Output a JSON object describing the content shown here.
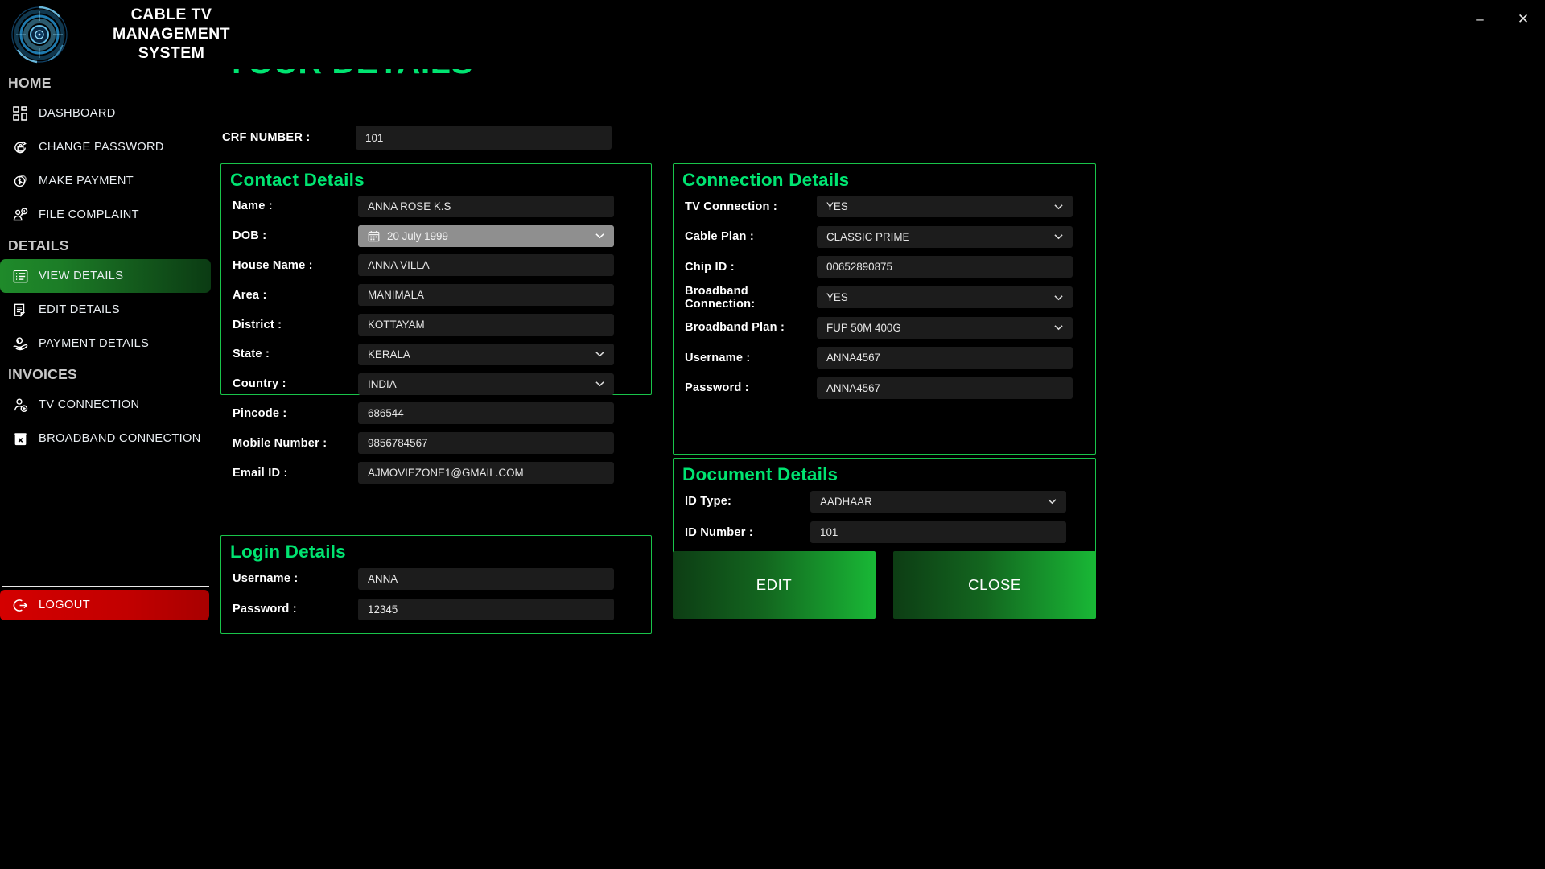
{
  "window": {
    "app_title": "CABLE TV MANAGEMENT SYSTEM",
    "minimize_label": "–",
    "close_label": "✕"
  },
  "sidebar": {
    "sections": [
      {
        "heading": "HOME",
        "items": [
          {
            "label": "DASHBOARD",
            "icon": "dashboard-grid-icon",
            "active": false
          },
          {
            "label": "CHANGE PASSWORD",
            "icon": "password-refresh-icon",
            "active": false
          },
          {
            "label": "MAKE PAYMENT",
            "icon": "coin-dollar-icon",
            "active": false
          },
          {
            "label": "FILE COMPLAINT",
            "icon": "complaint-person-icon",
            "active": false
          }
        ]
      },
      {
        "heading": "DETAILS",
        "items": [
          {
            "label": "VIEW  DETAILS",
            "icon": "view-list-icon",
            "active": true
          },
          {
            "label": "EDIT DETAILS",
            "icon": "edit-document-icon",
            "active": false
          },
          {
            "label": "PAYMENT DETAILS",
            "icon": "hand-money-icon",
            "active": false
          }
        ]
      },
      {
        "heading": "INVOICES",
        "items": [
          {
            "label": "TV CONNECTION",
            "icon": "user-add-icon",
            "active": false
          },
          {
            "label": "BROADBAND CONNECTION",
            "icon": "delete-box-icon",
            "active": false
          }
        ]
      }
    ],
    "logout": {
      "label": "LOGOUT",
      "icon": "logout-arrow-icon"
    }
  },
  "main": {
    "page_title": "YOUR DETAILS",
    "crf": {
      "label": "CRF NUMBER :",
      "value": "101"
    },
    "panels": {
      "contact": {
        "title": "Contact Details",
        "fields": [
          {
            "label": "Name :",
            "value": "ANNA ROSE K.S",
            "type": "text"
          },
          {
            "label": "DOB :",
            "value": "20 July 1999",
            "type": "date"
          },
          {
            "label": "House Name :",
            "value": "ANNA VILLA",
            "type": "text"
          },
          {
            "label": "Area :",
            "value": "MANIMALA",
            "type": "text"
          },
          {
            "label": "District :",
            "value": "KOTTAYAM",
            "type": "text"
          },
          {
            "label": "State :",
            "value": "KERALA",
            "type": "select"
          },
          {
            "label": "Country :",
            "value": "INDIA",
            "type": "select"
          },
          {
            "label": "Pincode :",
            "value": "686544",
            "type": "text"
          },
          {
            "label": "Mobile Number :",
            "value": "9856784567",
            "type": "text"
          },
          {
            "label": "Email ID :",
            "value": "AJMOVIEZONE1@GMAIL.COM",
            "type": "text"
          }
        ]
      },
      "login": {
        "title": "Login Details",
        "fields": [
          {
            "label": "Username :",
            "value": "ANNA",
            "type": "text"
          },
          {
            "label": "Password :",
            "value": "12345",
            "type": "text"
          }
        ]
      },
      "connection": {
        "title": "Connection Details",
        "fields": [
          {
            "label": "TV Connection  :",
            "value": "YES",
            "type": "select"
          },
          {
            "label": "Cable Plan :",
            "value": "CLASSIC PRIME",
            "type": "select"
          },
          {
            "label": "Chip ID :",
            "value": "00652890875",
            "type": "text"
          },
          {
            "label": "Broadband Connection:",
            "value": "YES",
            "type": "select"
          },
          {
            "label": "Broadband Plan :",
            "value": "FUP 50M 400G",
            "type": "select"
          },
          {
            "label": "Username :",
            "value": "ANNA4567",
            "type": "text"
          },
          {
            "label": "Password  :",
            "value": "ANNA4567",
            "type": "text"
          }
        ]
      },
      "document": {
        "title": "Document Details",
        "fields": [
          {
            "label": "ID Type:",
            "value": "AADHAAR",
            "type": "select"
          },
          {
            "label": "ID Number :",
            "value": "101",
            "type": "text"
          }
        ]
      }
    },
    "actions": {
      "edit_label": "EDIT",
      "close_label": "CLOSE"
    }
  },
  "colors": {
    "accent_green": "#00e471",
    "panel_border": "#19c44a",
    "logout_red": "#d40000",
    "field_bg": "#1c1c1c",
    "date_bg": "#8f8f8f"
  }
}
